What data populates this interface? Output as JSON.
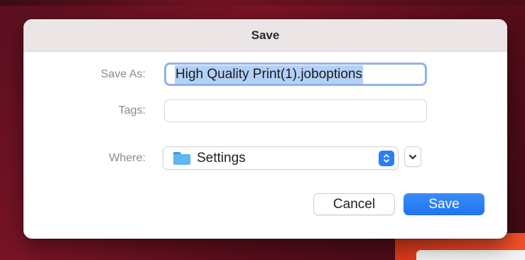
{
  "dialog": {
    "title": "Save",
    "save_as": {
      "label": "Save As:",
      "value": "High Quality Print(1).joboptions"
    },
    "tags": {
      "label": "Tags:",
      "value": ""
    },
    "where": {
      "label": "Where:",
      "selected": "Settings",
      "icon": "folder-icon"
    },
    "buttons": {
      "cancel": "Cancel",
      "save": "Save"
    }
  },
  "colors": {
    "accent": "#1f74f0",
    "selection": "#b3d1f6",
    "focus_ring": "#8fb4ea",
    "folder": "#5fb6f0",
    "background": "#6f1322"
  }
}
